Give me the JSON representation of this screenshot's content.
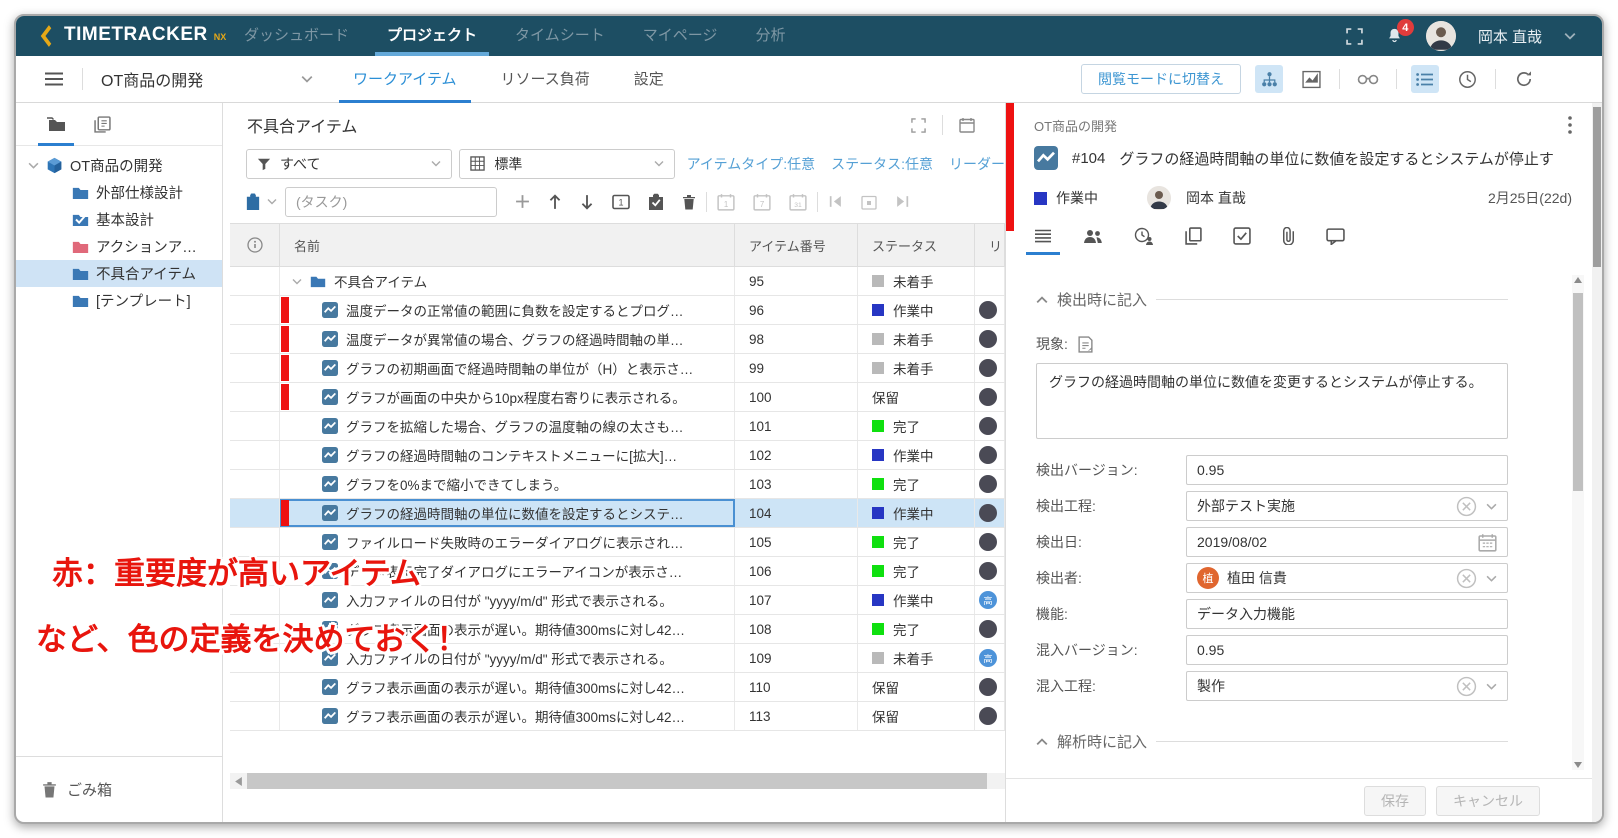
{
  "colors": {
    "topbar_bg": "#1d4e63",
    "accent_blue": "#2b8fd6",
    "active_underline": "#2b7fd0",
    "status_blue": "#2736c3",
    "status_green": "#0fe00f",
    "status_gray": "#b9b9b9",
    "important_red": "#ee1111",
    "selected_row_bg": "#cde4f6",
    "annotation_red": "#e8150d",
    "logo_gold": "#e6a817"
  },
  "topbar": {
    "brand": "TIMETRACKER",
    "brand_suffix": "NX",
    "nav": [
      {
        "label": "ダッシュボード",
        "cls": ""
      },
      {
        "label": "プロジェクト",
        "cls": "active"
      },
      {
        "label": "タイムシート",
        "cls": ""
      },
      {
        "label": "マイページ",
        "cls": ""
      },
      {
        "label": "分析",
        "cls": ""
      }
    ],
    "notification_count": "4",
    "user_name": "岡本 直哉"
  },
  "toolbar": {
    "project_selector": "OT商品の開発",
    "tabs": [
      {
        "label": "ワークアイテム",
        "cls": "active"
      },
      {
        "label": "リソース負荷",
        "cls": ""
      },
      {
        "label": "設定",
        "cls": ""
      }
    ],
    "view_mode_button": "閲覧モードに切替え"
  },
  "sidebar": {
    "tree": [
      {
        "label": "OT商品の開発",
        "cls": "root",
        "is_project": true,
        "is_folder": false,
        "folder_color": "",
        "has_check": false
      },
      {
        "label": "外部仕様設計",
        "cls": "lvl1",
        "is_project": false,
        "is_folder": true,
        "folder_color": "#3a78b5",
        "has_check": false
      },
      {
        "label": "基本設計",
        "cls": "lvl1",
        "is_project": false,
        "is_folder": true,
        "folder_color": "#3a78b5",
        "has_check": true
      },
      {
        "label": "アクションア…",
        "cls": "lvl1",
        "is_project": false,
        "is_folder": true,
        "folder_color": "#e0697a",
        "has_check": false
      },
      {
        "label": "不具合アイテム",
        "cls": "lvl1 selected",
        "is_project": false,
        "is_folder": true,
        "folder_color": "#3a78b5",
        "has_check": false
      },
      {
        "label": "[テンプレート]",
        "cls": "lvl1",
        "is_project": false,
        "is_folder": true,
        "folder_color": "#3a78b5",
        "has_check": false
      }
    ],
    "trash_label": "ごみ箱"
  },
  "list_panel": {
    "title": "不具合アイテム",
    "filter_value": "すべて",
    "view_value": "標準",
    "quick_filters": [
      {
        "label": "アイテムタイプ:任意"
      },
      {
        "label": "ステータス:任意"
      },
      {
        "label": "リーダー"
      }
    ],
    "new_item_placeholder": "(タスク)",
    "columns": {
      "name": "名前",
      "number": "アイテム番号",
      "status": "ステータス",
      "leader": "リ"
    },
    "rows": [
      {
        "name": "不具合アイテム",
        "number": "95",
        "status": "未着手",
        "status_color": "#b9b9b9",
        "cls": "folder",
        "is_folder": true,
        "important": false,
        "has_avatar": false,
        "avatar_char": "",
        "avatar_color": ""
      },
      {
        "name": "温度データの正常値の範囲に負数を設定するとプログ…",
        "number": "96",
        "status": "作業中",
        "status_color": "#2736c3",
        "cls": "",
        "is_folder": false,
        "important": true,
        "has_avatar": true,
        "avatar_char": "",
        "avatar_color": "#4a4a55"
      },
      {
        "name": "温度データが異常値の場合、グラフの経過時間軸の単…",
        "number": "98",
        "status": "未着手",
        "status_color": "#b9b9b9",
        "cls": "",
        "is_folder": false,
        "important": true,
        "has_avatar": true,
        "avatar_char": "",
        "avatar_color": "#4a4a55"
      },
      {
        "name": "グラフの初期画面で経過時間軸の単位が（H）と表示さ…",
        "number": "99",
        "status": "未着手",
        "status_color": "#b9b9b9",
        "cls": "",
        "is_folder": false,
        "important": true,
        "has_avatar": true,
        "avatar_char": "",
        "avatar_color": "#4a4a55"
      },
      {
        "name": "グラフが画面の中央から10px程度右寄りに表示される。",
        "number": "100",
        "status": "保留",
        "status_color": "",
        "cls": "",
        "is_folder": false,
        "important": true,
        "has_avatar": true,
        "avatar_char": "",
        "avatar_color": "#4a4a55"
      },
      {
        "name": "グラフを拡縮した場合、グラフの温度軸の線の太さも…",
        "number": "101",
        "status": "完了",
        "status_color": "#0fe00f",
        "cls": "",
        "is_folder": false,
        "important": false,
        "has_avatar": true,
        "avatar_char": "",
        "avatar_color": "#4a4a55"
      },
      {
        "name": "グラフの経過時間軸のコンテキストメニューに[拡大]…",
        "number": "102",
        "status": "作業中",
        "status_color": "#2736c3",
        "cls": "",
        "is_folder": false,
        "important": false,
        "has_avatar": true,
        "avatar_char": "",
        "avatar_color": "#4a4a55"
      },
      {
        "name": "グラフを0%まで縮小できてしまう。",
        "number": "103",
        "status": "完了",
        "status_color": "#0fe00f",
        "cls": "",
        "is_folder": false,
        "important": false,
        "has_avatar": true,
        "avatar_char": "",
        "avatar_color": "#4a4a55"
      },
      {
        "name": "グラフの経過時間軸の単位に数値を設定するとシステ…",
        "number": "104",
        "status": "作業中",
        "status_color": "#2736c3",
        "cls": "selected",
        "is_folder": false,
        "important": true,
        "has_avatar": true,
        "avatar_char": "",
        "avatar_color": "#4a4a55"
      },
      {
        "name": "ファイルロード失敗時のエラーダイアログに表示され…",
        "number": "105",
        "status": "完了",
        "status_color": "#0fe00f",
        "cls": "",
        "is_folder": false,
        "important": false,
        "has_avatar": true,
        "avatar_char": "",
        "avatar_color": "#4a4a55"
      },
      {
        "name": "データ表示完了ダイアログにエラーアイコンが表示さ…",
        "number": "106",
        "status": "完了",
        "status_color": "#0fe00f",
        "cls": "",
        "is_folder": false,
        "important": false,
        "has_avatar": true,
        "avatar_char": "",
        "avatar_color": "#4a4a55"
      },
      {
        "name": "入力ファイルの日付が \"yyyy/m/d\" 形式で表示される。",
        "number": "107",
        "status": "作業中",
        "status_color": "#2736c3",
        "cls": "",
        "is_folder": false,
        "important": false,
        "has_avatar": true,
        "avatar_char": "高",
        "avatar_color": "#4d93d9"
      },
      {
        "name": "グラフ表示画面の表示が遅い。期待値300msに対し42…",
        "number": "108",
        "status": "完了",
        "status_color": "#0fe00f",
        "cls": "",
        "is_folder": false,
        "important": false,
        "has_avatar": true,
        "avatar_char": "",
        "avatar_color": "#4a4a55"
      },
      {
        "name": "入力ファイルの日付が \"yyyy/m/d\" 形式で表示される。",
        "number": "109",
        "status": "未着手",
        "status_color": "#b9b9b9",
        "cls": "",
        "is_folder": false,
        "important": false,
        "has_avatar": true,
        "avatar_char": "高",
        "avatar_color": "#4d93d9"
      },
      {
        "name": "グラフ表示画面の表示が遅い。期待値300msに対し42…",
        "number": "110",
        "status": "保留",
        "status_color": "",
        "cls": "",
        "is_folder": false,
        "important": false,
        "has_avatar": true,
        "avatar_char": "",
        "avatar_color": "#4a4a55"
      },
      {
        "name": "グラフ表示画面の表示が遅い。期待値300msに対し42…",
        "number": "113",
        "status": "保留",
        "status_color": "",
        "cls": "",
        "is_folder": false,
        "important": false,
        "has_avatar": true,
        "avatar_char": "",
        "avatar_color": "#4a4a55"
      }
    ]
  },
  "detail_panel": {
    "project": "OT商品の開発",
    "item_number": "#104",
    "title": "グラフの経過時間軸の単位に数値を設定するとシステムが停止す",
    "status": "作業中",
    "assignee": "岡本 直哉",
    "due": "2月25日(22d)",
    "section1": "検出時に記入",
    "phenomenon_label": "現象:",
    "phenomenon_text": "グラフの経過時間軸の単位に数値を変更するとシステムが停止する。",
    "fields": [
      {
        "label": "検出バージョン:",
        "value": "0.95",
        "has_clear": false,
        "has_cal": false,
        "has_person": false,
        "avatar_char": "",
        "avatar_color": ""
      },
      {
        "label": "検出工程:",
        "value": "外部テスト実施",
        "has_clear": true,
        "has_cal": false,
        "has_person": false,
        "avatar_char": "",
        "avatar_color": ""
      },
      {
        "label": "検出日:",
        "value": "2019/08/02",
        "has_clear": false,
        "has_cal": true,
        "has_person": false,
        "avatar_char": "",
        "avatar_color": ""
      },
      {
        "label": "検出者:",
        "value": "植田 信貴",
        "has_clear": true,
        "has_cal": false,
        "has_person": true,
        "avatar_char": "植",
        "avatar_color": "#e0662f"
      },
      {
        "label": "機能:",
        "value": "データ入力機能",
        "has_clear": false,
        "has_cal": false,
        "has_person": false,
        "avatar_char": "",
        "avatar_color": ""
      },
      {
        "label": "混入バージョン:",
        "value": "0.95",
        "has_clear": false,
        "has_cal": false,
        "has_person": false,
        "avatar_char": "",
        "avatar_color": ""
      },
      {
        "label": "混入工程:",
        "value": "製作",
        "has_clear": true,
        "has_cal": false,
        "has_person": false,
        "avatar_char": "",
        "avatar_color": ""
      }
    ],
    "section2": "解析時に記入",
    "save_label": "保存",
    "cancel_label": "キャンセル"
  },
  "annotation": {
    "line1": "赤：重要度が高いアイテム",
    "line2": "など、色の定義を決めておく！"
  }
}
